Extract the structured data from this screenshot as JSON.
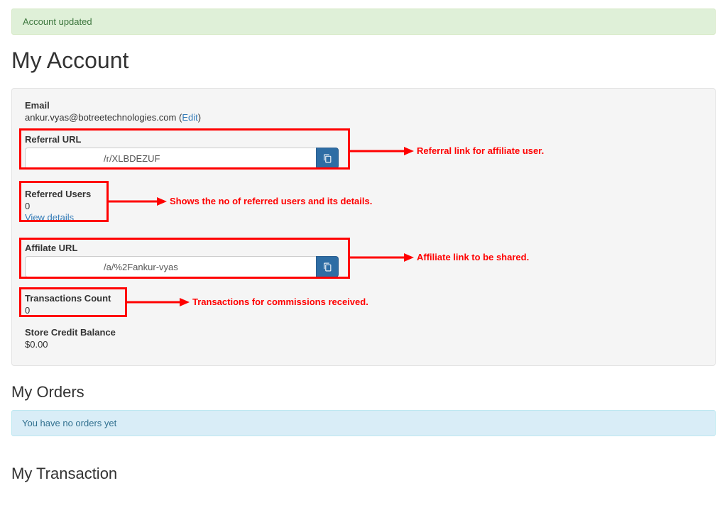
{
  "alert": "Account updated",
  "page_title": "My Account",
  "account": {
    "email_label": "Email",
    "email_value": "ankur.vyas@botreetechnologies.com",
    "edit_link": "Edit",
    "referral_label": "Referral URL",
    "referral_value": "/r/XLBDEZUF",
    "referred_label": "Referred Users",
    "referred_count": "0",
    "view_details": "View details",
    "affiliate_label": "Affilate URL",
    "affiliate_value": "/a/%2Fankur-vyas",
    "transactions_label": "Transactions Count",
    "transactions_count": "0",
    "credit_label": "Store Credit Balance",
    "credit_value": "$0.00"
  },
  "annotations": {
    "referral": "Referral link for affiliate user.",
    "referred": "Shows the no of referred users and its details.",
    "affiliate": "Affiliate link to be shared.",
    "transactions": "Transactions for commissions received."
  },
  "orders": {
    "heading": "My Orders",
    "empty": "You have no orders yet"
  },
  "transaction_heading": "My Transaction"
}
